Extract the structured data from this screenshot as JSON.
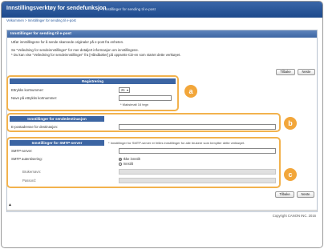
{
  "header": {
    "app_title": "Innstillingsverktøy for sendefunksjon",
    "subtitle": "Innstillinger for sending til e-post",
    "breadcrumb": "Velkommen > Innstillinger for sending til e-post"
  },
  "panel": {
    "title": "Innstillinger for sending til e-post",
    "intro_line1": "Utfør innstillingene for å sende skannede originaler på e-post fra enheten.",
    "intro_line2": "Se \"Veiledning for sendeinnstillinger\" for mer detaljert informasjon om innstillingene.",
    "intro_line3": "* Du kan vise \"Veiledning for sendeinnstillinger\" fra [Håndbøker] på oppsetts-CD-en som startet dette verktøyet."
  },
  "buttons": {
    "back": "Tilbake",
    "next": "Neste"
  },
  "registration": {
    "title": "Registrering",
    "label_number": "Ettrykks kortnummer:",
    "number_value": "21",
    "label_name": "Navn på ettrykks kortnummer:",
    "name_value": "",
    "max_note": "* Maksimalt 16 tegn"
  },
  "destination": {
    "title": "Innstillinger for sendedestinasjon",
    "label_email": "E-postadresse for destinasjon:",
    "email_value": ""
  },
  "smtp": {
    "title": "Innstillinger for SMTP-server",
    "note": "* Innstillinger for SMTP-server er felles innstillinger for alle brukere som benytter dette verktøyet.",
    "label_server": "SMTP-server:",
    "server_value": "",
    "label_auth": "SMTP autentisering:",
    "auth_off": "Ikke innstilt",
    "auth_on": "Innstilt",
    "auth_selected": "off",
    "label_user": "Brukernavn:",
    "label_password": "Passord:"
  },
  "badges": {
    "a": "a",
    "b": "b",
    "c": "c"
  },
  "footer": {
    "copyright": "Copyright CANON INC. 2016"
  }
}
